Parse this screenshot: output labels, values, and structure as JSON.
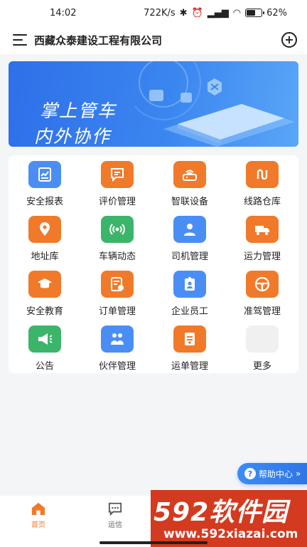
{
  "status_bar": {
    "time": "14:02",
    "network_speed": "722K/s",
    "signal": "\tull",
    "battery": "62%",
    "battery_level": 0.62
  },
  "header": {
    "company": "西藏众泰建设工程有限公司"
  },
  "banner": {
    "line1": "掌上管车",
    "line2": "内外协作"
  },
  "grid": [
    {
      "label": "安全报表",
      "icon": "chart-report-icon",
      "color": "#4a8ef5"
    },
    {
      "label": "评价管理",
      "icon": "comment-icon",
      "color": "#f07a2a"
    },
    {
      "label": "智联设备",
      "icon": "device-icon",
      "color": "#f07a2a"
    },
    {
      "label": "线路仓库",
      "icon": "route-icon",
      "color": "#f07a2a"
    },
    {
      "label": "地址库",
      "icon": "location-pin-icon",
      "color": "#f07a2a"
    },
    {
      "label": "车辆动态",
      "icon": "signal-broadcast-icon",
      "color": "#3bb56a"
    },
    {
      "label": "司机管理",
      "icon": "driver-icon",
      "color": "#4a8ef5"
    },
    {
      "label": "运力管理",
      "icon": "truck-icon",
      "color": "#f07a2a"
    },
    {
      "label": "安全教育",
      "icon": "graduation-cap-icon",
      "color": "#f07a2a"
    },
    {
      "label": "订单管理",
      "icon": "order-icon",
      "color": "#f07a2a"
    },
    {
      "label": "企业员工",
      "icon": "badge-icon",
      "color": "#4a8ef5"
    },
    {
      "label": "准驾管理",
      "icon": "steering-wheel-icon",
      "color": "#f07a2a"
    },
    {
      "label": "公告",
      "icon": "megaphone-icon",
      "color": "#3bb56a"
    },
    {
      "label": "伙伴管理",
      "icon": "partners-icon",
      "color": "#4a8ef5"
    },
    {
      "label": "运单管理",
      "icon": "waybill-icon",
      "color": "#f07a2a"
    },
    {
      "label": "更多",
      "icon": "more-apps-icon",
      "color": "#f0f0f0"
    }
  ],
  "help": {
    "label": "帮助中心",
    "arrow": "»"
  },
  "tabs": [
    {
      "label": "首页",
      "icon": "home-icon",
      "active": true
    },
    {
      "label": "运信",
      "icon": "message-icon",
      "active": false
    }
  ],
  "watermark": {
    "brand": "592软件园",
    "url": "www.592xiazai.com"
  }
}
